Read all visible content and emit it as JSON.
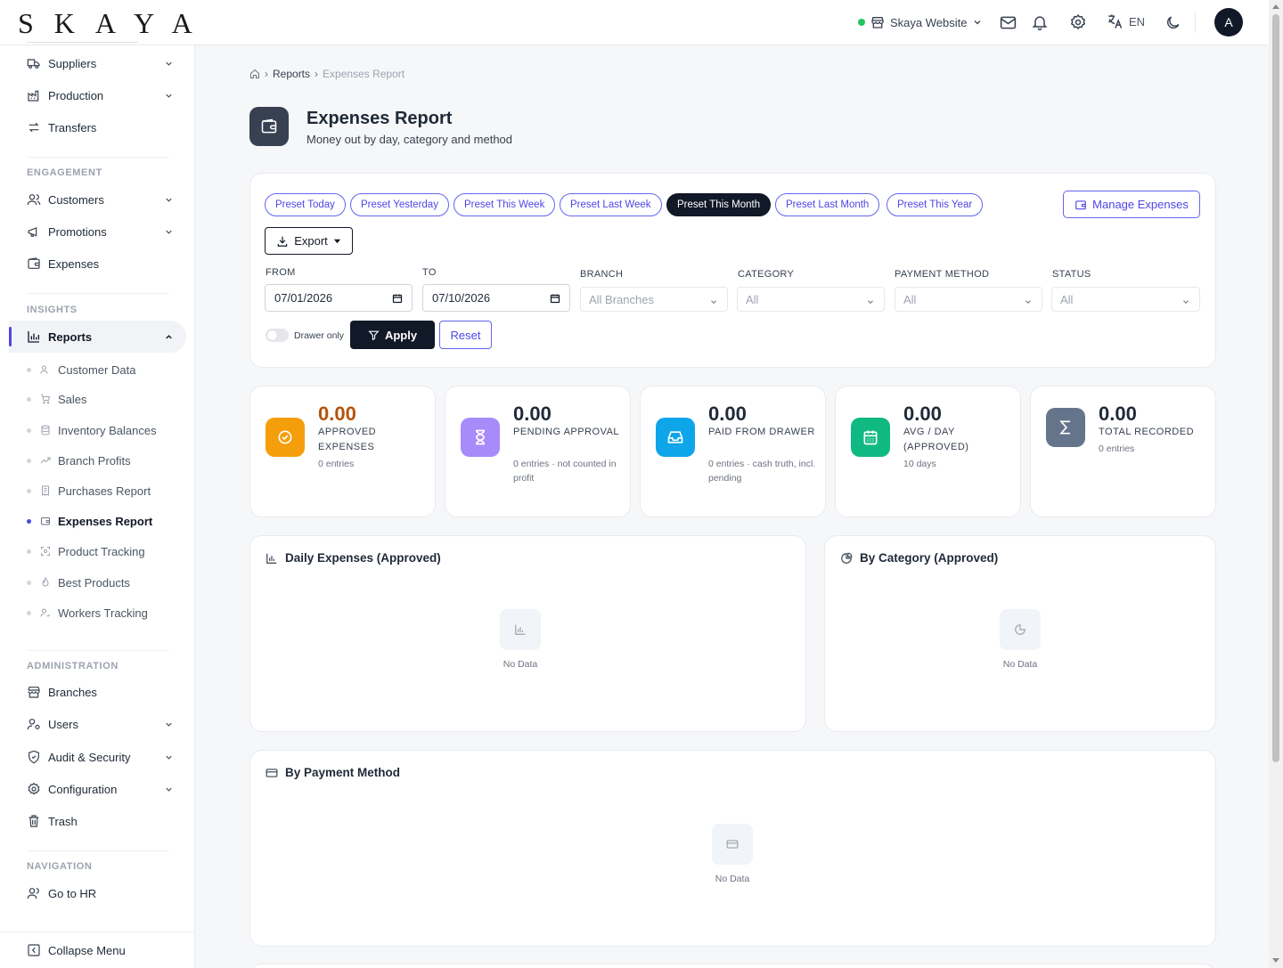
{
  "brand": {
    "logo_text": "SKAYA"
  },
  "topbar": {
    "branch_name": "Skaya Website",
    "language": "EN",
    "avatar_initial": "A"
  },
  "sidebar": {
    "items_top": [
      {
        "label": "Suppliers",
        "icon": "truck-icon",
        "expandable": true
      },
      {
        "label": "Production",
        "icon": "factory-icon",
        "expandable": true
      },
      {
        "label": "Transfers",
        "icon": "arrows-icon",
        "expandable": false
      }
    ],
    "section_engagement": "ENGAGEMENT",
    "items_engagement": [
      {
        "label": "Customers",
        "icon": "users-icon",
        "expandable": true
      },
      {
        "label": "Promotions",
        "icon": "megaphone-icon",
        "expandable": true
      },
      {
        "label": "Expenses",
        "icon": "wallet-icon",
        "expandable": false
      }
    ],
    "section_insights": "INSIGHTS",
    "reports_label": "Reports",
    "report_subitems": [
      {
        "label": "Customer Data",
        "icon": "users-icon"
      },
      {
        "label": "Sales",
        "icon": "cart-icon"
      },
      {
        "label": "Inventory Balances",
        "icon": "database-icon"
      },
      {
        "label": "Branch Profits",
        "icon": "trend-icon"
      },
      {
        "label": "Purchases Report",
        "icon": "receipt-icon"
      },
      {
        "label": "Expenses Report",
        "icon": "wallet-icon",
        "active": true
      },
      {
        "label": "Product Tracking",
        "icon": "scan-icon"
      },
      {
        "label": "Best Products",
        "icon": "flame-icon"
      },
      {
        "label": "Workers Tracking",
        "icon": "user-check-icon"
      }
    ],
    "section_administration": "ADMINISTRATION",
    "items_admin": [
      {
        "label": "Branches",
        "icon": "store-icon",
        "expandable": false
      },
      {
        "label": "Users",
        "icon": "user-cog-icon",
        "expandable": true
      },
      {
        "label": "Audit & Security",
        "icon": "shield-icon",
        "expandable": true
      },
      {
        "label": "Configuration",
        "icon": "gear-icon",
        "expandable": true
      },
      {
        "label": "Trash",
        "icon": "trash-icon",
        "expandable": false
      }
    ],
    "section_navigation": "NAVIGATION",
    "go_to_hr": "Go to HR",
    "collapse_menu": "Collapse Menu"
  },
  "breadcrumb": {
    "parent": "Reports",
    "current": "Expenses Report"
  },
  "page": {
    "title": "Expenses Report",
    "subtitle": "Money out by day, category and method"
  },
  "filters": {
    "presets": [
      {
        "label": "Preset Today",
        "active": false
      },
      {
        "label": "Preset Yesterday",
        "active": false
      },
      {
        "label": "Preset This Week",
        "active": false
      },
      {
        "label": "Preset Last Week",
        "active": false
      },
      {
        "label": "Preset This Month",
        "active": true
      },
      {
        "label": "Preset Last Month",
        "active": false
      },
      {
        "label": "Preset This Year",
        "active": false
      }
    ],
    "manage_expenses": "Manage Expenses",
    "export": "Export",
    "from_label": "FROM",
    "from_value": "07/01/2026",
    "to_label": "TO",
    "to_value": "07/10/2026",
    "branch_label": "BRANCH",
    "branch_value": "All Branches",
    "category_label": "CATEGORY",
    "category_value": "All",
    "payment_label": "PAYMENT METHOD",
    "payment_value": "All",
    "status_label": "STATUS",
    "status_value": "All",
    "drawer_only": "Drawer only",
    "drawer_only_on": false,
    "apply": "Apply",
    "reset": "Reset"
  },
  "stats": [
    {
      "value": "0.00",
      "label": "APPROVED EXPENSES",
      "note": "0 entries",
      "color": "#f59e0b",
      "value_color": "#b45309",
      "icon": "check-circle-icon"
    },
    {
      "value": "0.00",
      "label": "PENDING APPROVAL",
      "note": "0 entries · not counted in profit",
      "color": "#a78bfa",
      "value_color": "#1f2937",
      "icon": "hourglass-icon"
    },
    {
      "value": "0.00",
      "label": "PAID FROM DRAWER",
      "note": "0 entries · cash truth, incl. pending",
      "color": "#0ea5e9",
      "value_color": "#1f2937",
      "icon": "inbox-icon"
    },
    {
      "value": "0.00",
      "label": "AVG / DAY (APPROVED)",
      "note": "10 days",
      "color": "#10b981",
      "value_color": "#1f2937",
      "icon": "calendar-icon"
    },
    {
      "value": "0.00",
      "label": "TOTAL RECORDED",
      "note": "0 entries",
      "color": "#64748b",
      "value_color": "#1f2937",
      "icon": "sigma-icon"
    }
  ],
  "panels": {
    "daily": {
      "title": "Daily Expenses (Approved)",
      "empty": "No Data"
    },
    "category": {
      "title": "By Category (Approved)",
      "empty": "No Data"
    },
    "payment": {
      "title": "By Payment Method",
      "empty": "No Data"
    }
  }
}
